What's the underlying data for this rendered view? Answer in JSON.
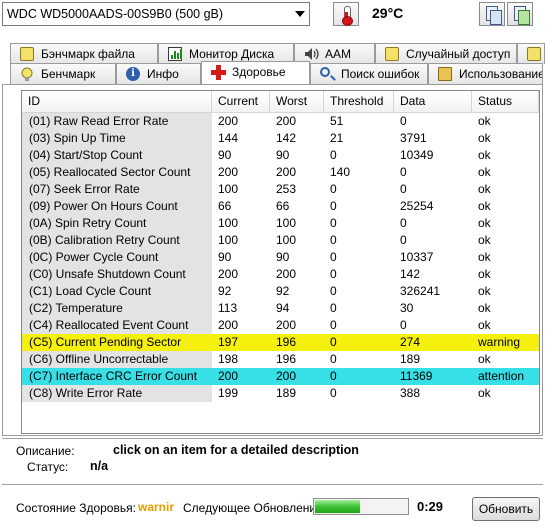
{
  "toolbar": {
    "drive": "WDC WD5000AADS-00S9B0 (500 gB)",
    "temperature": "29°C",
    "icons": {
      "temperature": "thermometer-icon",
      "copy": "copy-icon",
      "export": "export-icon"
    }
  },
  "tabs_back": [
    {
      "label": "Бэнчмарк файла",
      "icon": "file-benchmark-icon"
    },
    {
      "label": "Монитор Диска",
      "icon": "disk-monitor-icon"
    },
    {
      "label": "AAM",
      "icon": "speaker-icon"
    },
    {
      "label": "Случайный доступ",
      "icon": "random-access-icon"
    },
    {
      "label": "Э",
      "icon": "extra-icon"
    }
  ],
  "tabs_front": [
    {
      "label": "Бенчмарк",
      "icon": "benchmark-icon"
    },
    {
      "label": "Инфо",
      "icon": "info-icon"
    },
    {
      "label": "Здоровье",
      "icon": "health-cross-icon",
      "active": true
    },
    {
      "label": "Поиск ошибок",
      "icon": "search-icon"
    },
    {
      "label": "Использование",
      "icon": "folder-icon"
    }
  ],
  "smart": {
    "columns": [
      "ID",
      "Current",
      "Worst",
      "Threshold",
      "Data",
      "Status"
    ],
    "rows": [
      [
        "(01) Raw Read Error Rate",
        "200",
        "200",
        "51",
        "0",
        "ok"
      ],
      [
        "(03) Spin Up Time",
        "144",
        "142",
        "21",
        "3791",
        "ok"
      ],
      [
        "(04) Start/Stop Count",
        "90",
        "90",
        "0",
        "10349",
        "ok"
      ],
      [
        "(05) Reallocated Sector Count",
        "200",
        "200",
        "140",
        "0",
        "ok"
      ],
      [
        "(07) Seek Error Rate",
        "100",
        "253",
        "0",
        "0",
        "ok"
      ],
      [
        "(09) Power On Hours Count",
        "66",
        "66",
        "0",
        "25254",
        "ok"
      ],
      [
        "(0A) Spin Retry Count",
        "100",
        "100",
        "0",
        "0",
        "ok"
      ],
      [
        "(0B) Calibration Retry Count",
        "100",
        "100",
        "0",
        "0",
        "ok"
      ],
      [
        "(0C) Power Cycle Count",
        "90",
        "90",
        "0",
        "10337",
        "ok"
      ],
      [
        "(C0) Unsafe Shutdown Count",
        "200",
        "200",
        "0",
        "142",
        "ok"
      ],
      [
        "(C1) Load Cycle Count",
        "92",
        "92",
        "0",
        "326241",
        "ok"
      ],
      [
        "(C2) Temperature",
        "113",
        "94",
        "0",
        "30",
        "ok"
      ],
      [
        "(C4) Reallocated Event Count",
        "200",
        "200",
        "0",
        "0",
        "ok"
      ],
      [
        "(C5) Current Pending Sector",
        "197",
        "196",
        "0",
        "274",
        "warning"
      ],
      [
        "(C6) Offline Uncorrectable",
        "198",
        "196",
        "0",
        "189",
        "ok"
      ],
      [
        "(C7) Interface CRC Error Count",
        "200",
        "200",
        "0",
        "11369",
        "attention"
      ],
      [
        "(C8) Write Error Rate",
        "199",
        "189",
        "0",
        "388",
        "ok"
      ]
    ],
    "highlight": {
      "warning": "#f5f00e",
      "attention": "#37dfe6"
    }
  },
  "details": {
    "description_label": "Описание:",
    "description_value": "click on an item for a detailed description",
    "status_label": "Статус:",
    "status_value": "n/a"
  },
  "footer": {
    "health_label": "Состояние Здоровья:",
    "health_value": "warnir",
    "next_update_label": "Следующее Обновление:",
    "progress_fraction": 0.48,
    "countdown": "0:29",
    "refresh_label": "Обновить"
  }
}
